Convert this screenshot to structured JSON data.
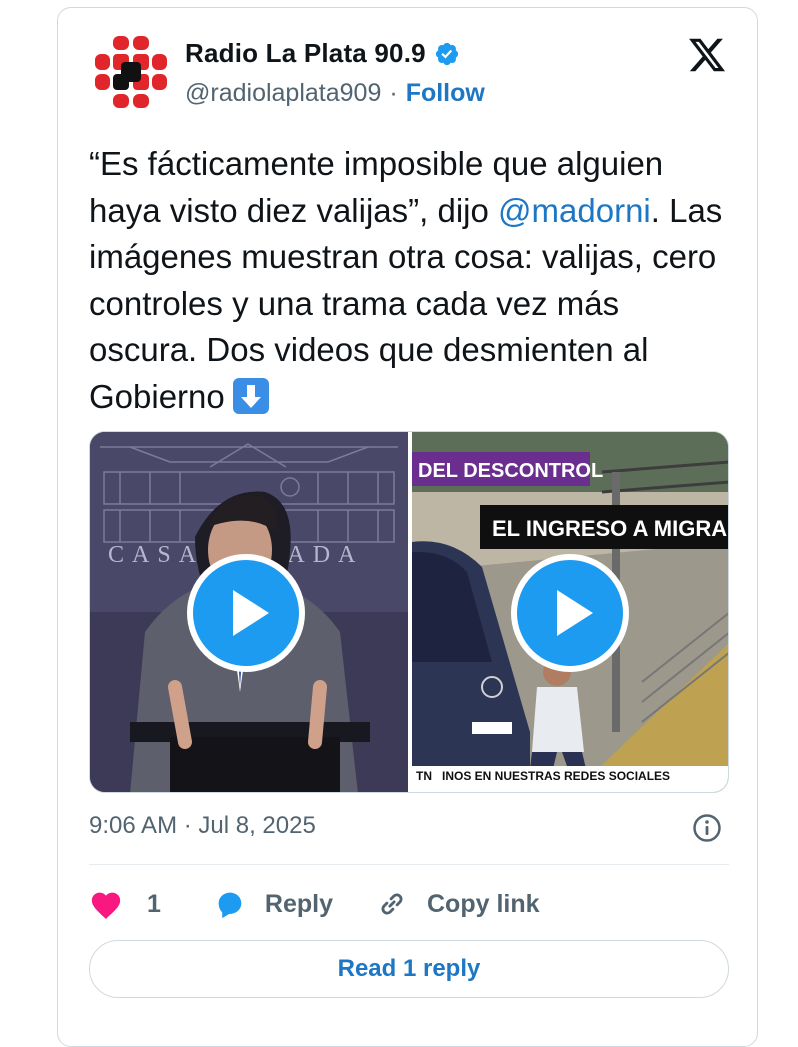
{
  "author": {
    "display_name": "Radio La Plata 90.9",
    "handle": "@radiolaplata909",
    "separator": "·",
    "follow_label": "Follow"
  },
  "tweet": {
    "text_part1": "“Es fácticamente imposible que alguien haya visto diez valijas”, dijo ",
    "mention": "@madorni",
    "text_part2": ". Las imágenes muestran otra cosa: valijas, cero controles y una trama cada vez más oscura. Dos videos que desmienten al Gobierno",
    "emoji": "down-arrow-emoji"
  },
  "media": {
    "video1": {
      "caption_text": "CASA ROSADA",
      "icon": "play-icon"
    },
    "video2": {
      "overlay_tag": "DEL DESCONTROL",
      "overlay_title": "EL INGRESO A MIGRACI",
      "ticker_source": "TN",
      "ticker_text": "INOS EN NUESTRAS REDES SOCIALES",
      "icon": "play-icon"
    }
  },
  "timestamp": "9:06 AM · Jul 8, 2025",
  "actions": {
    "like_count": "1",
    "reply_label": "Reply",
    "copy_link_label": "Copy link"
  },
  "read_replies_label": "Read 1 reply",
  "colors": {
    "link_blue": "#1d77c4",
    "heart_pink": "#f91880",
    "play_blue": "#1d9bf0",
    "avatar_red": "#e0262b"
  }
}
